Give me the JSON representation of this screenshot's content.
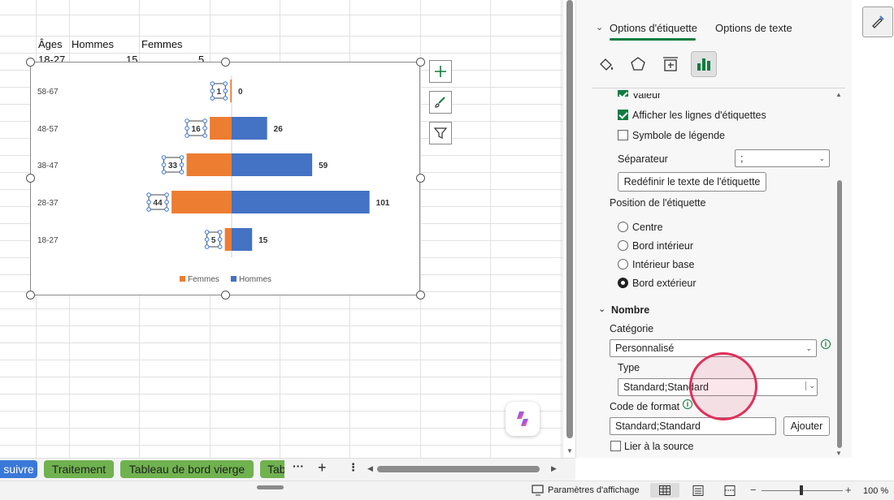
{
  "sheet": {
    "headers": [
      "Âges",
      "Hommes",
      "Femmes"
    ],
    "partial_row": {
      "label": "18-27",
      "hommes": "15",
      "femmes": "5"
    }
  },
  "chart_data": {
    "type": "bar",
    "orientation": "horizontal",
    "categories": [
      "58-67",
      "48-57",
      "38-47",
      "28-37",
      "18-27"
    ],
    "series": [
      {
        "name": "Femmes",
        "values": [
          1,
          16,
          33,
          44,
          5
        ],
        "color": "#ed7d31"
      },
      {
        "name": "Hommes",
        "values": [
          0,
          26,
          59,
          101,
          15
        ],
        "color": "#4472c4"
      }
    ],
    "legend": "bottom",
    "grid": false
  },
  "chart_buttons": {
    "add": "plus-icon",
    "style": "brush-icon",
    "filter": "filter-icon"
  },
  "pane": {
    "tab_label_options": "Options d'étiquette",
    "tab_text_options": "Options de texte",
    "icons": [
      "fill-icon",
      "pentagon-icon",
      "size-icon",
      "chart-bars-icon"
    ],
    "checkbox_valeur": "Valeur",
    "checkbox_lignes": "Afficher les lignes d'étiquettes",
    "checkbox_symbole": "Symbole de légende",
    "separateur_label": "Séparateur",
    "separateur_value": ";",
    "reset_button": "Redéfinir le texte de l'étiquette",
    "position_title": "Position de l'étiquette",
    "positions": [
      "Centre",
      "Bord intérieur",
      "Intérieur base",
      "Bord extérieur"
    ],
    "nombre_title": "Nombre",
    "categorie_label": "Catégorie",
    "categorie_value": "Personnalisé",
    "type_label": "Type",
    "type_value": "Standard;Standard",
    "code_label": "Code de format",
    "code_value": "Standard;Standard",
    "ajouter": "Ajouter",
    "lier": "Lier à la source"
  },
  "sheet_tabs": [
    "suivre",
    "Traitement",
    "Tableau de bord vierge",
    "Tab"
  ],
  "status": {
    "display_settings": "Paramètres d'affichage",
    "zoom": "100 %"
  },
  "colors": {
    "accent": "#107c41",
    "highlight": "#e0305a"
  }
}
